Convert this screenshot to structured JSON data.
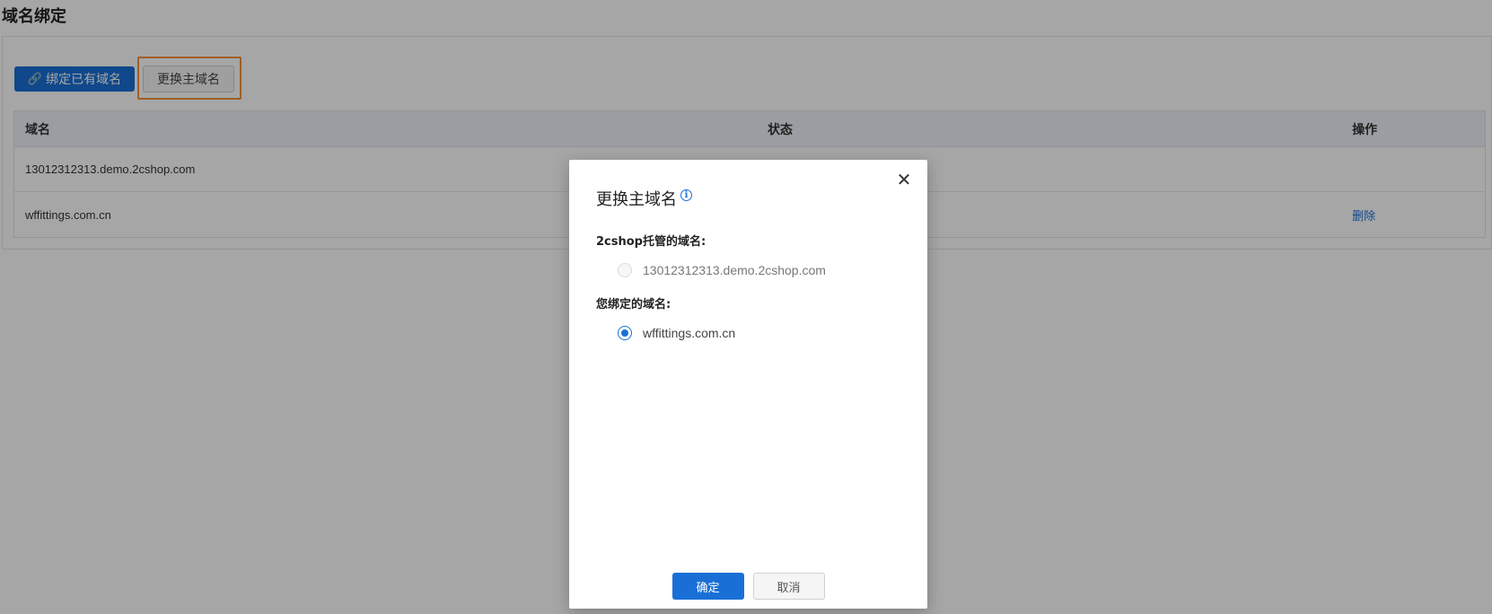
{
  "page": {
    "title": "域名绑定"
  },
  "toolbar": {
    "bind_existing_label": "绑定已有域名",
    "change_primary_label": "更换主域名",
    "link_icon": "link-icon"
  },
  "table": {
    "columns": [
      "域名",
      "状态",
      "操作"
    ],
    "rows": [
      {
        "domain": "13012312313.demo.2cshop.com",
        "status": "",
        "action": ""
      },
      {
        "domain": "wffittings.com.cn",
        "status": "",
        "action": "删除"
      }
    ]
  },
  "modal": {
    "title": "更换主域名",
    "info_icon": "info-icon",
    "close_icon": "close-icon",
    "hosted_section_label": "2cshop托管的域名:",
    "hosted_domains": [
      {
        "label": "13012312313.demo.2cshop.com",
        "checked": false,
        "disabled": true
      }
    ],
    "bound_section_label": "您绑定的域名:",
    "bound_domains": [
      {
        "label": "wffittings.com.cn",
        "checked": true,
        "disabled": false
      }
    ],
    "ok_label": "确定",
    "cancel_label": "取消"
  },
  "colors": {
    "primary": "#1a6fd6",
    "highlight": "#f5923e",
    "overlay": "rgba(0,0,0,0.35)"
  }
}
